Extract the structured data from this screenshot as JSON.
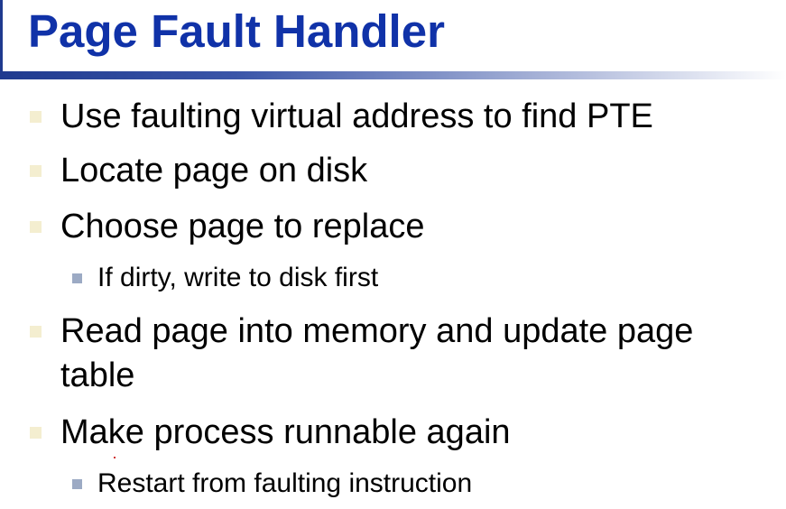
{
  "slide": {
    "title": "Page Fault Handler",
    "colors": {
      "title": "#1032a8",
      "rule": "#1f3a8f",
      "bullet_level1": "#f4eed0",
      "bullet_level2": "#9caac4"
    },
    "bullets": [
      {
        "level": 1,
        "text": "Use faulting virtual address to find PTE"
      },
      {
        "level": 1,
        "text": "Locate page on disk"
      },
      {
        "level": 1,
        "text": "Choose page to replace"
      },
      {
        "level": 2,
        "text": "If dirty, write to disk first"
      },
      {
        "level": 1,
        "text": "Read page into memory and update page"
      },
      {
        "level": 1,
        "text": "table"
      },
      {
        "level": 1,
        "text": "Make process runnable again"
      },
      {
        "level": 2,
        "text": "Restart from faulting instruction"
      }
    ]
  }
}
